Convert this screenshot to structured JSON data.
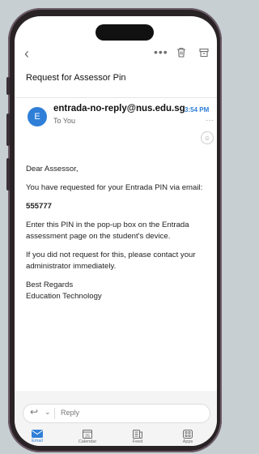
{
  "subject": "Request for Assessor Pin",
  "email": {
    "avatar_initial": "E",
    "sender": "entrada-no-reply@nus.edu.sg",
    "to": "To You",
    "time": "3:54 PM",
    "greeting": "Dear Assessor,",
    "line1": "You have requested for your Entrada PIN via email:",
    "pin": "555777",
    "line2": "Enter this PIN in the pop-up box on the Entrada assessment page on the student's device.",
    "line3": "If you did not request for this, please contact your administrator immediately.",
    "signoff1": "Best Regards",
    "signoff2": "Education Technology"
  },
  "reply": {
    "label": "Reply"
  },
  "tabs": [
    {
      "label": "Email",
      "icon": "mail-icon"
    },
    {
      "label": "Calendar",
      "icon": "calendar-icon"
    },
    {
      "label": "Feed",
      "icon": "feed-icon"
    },
    {
      "label": "Apps",
      "icon": "apps-icon"
    }
  ],
  "calendar_day": "25",
  "colors": {
    "accent": "#2f7fd8",
    "frame": "#2a2326"
  }
}
